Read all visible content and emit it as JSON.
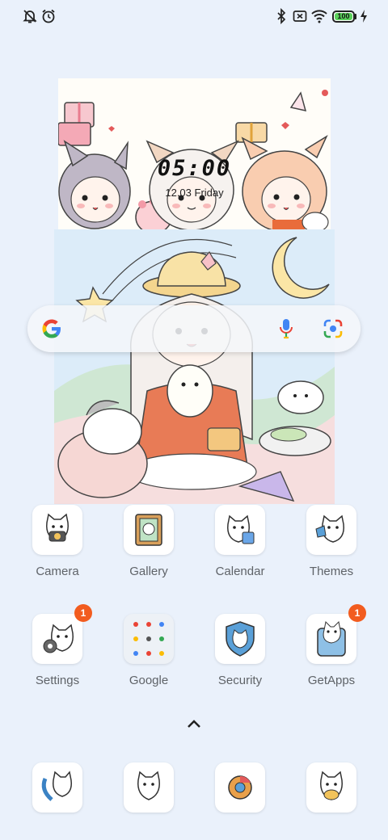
{
  "status": {
    "battery": "100",
    "battery_level_percent": 100,
    "icons": [
      "mute-bell-icon",
      "alarm-icon",
      "bluetooth-icon",
      "no-sim-icon",
      "wifi-icon",
      "battery-icon",
      "charging-bolt-icon"
    ]
  },
  "widget": {
    "time": "05:00",
    "date": "12.03 Friday"
  },
  "search": {
    "icons": [
      "google-logo",
      "mic-icon",
      "lens-icon"
    ]
  },
  "apps": {
    "row1": [
      {
        "label": "Camera"
      },
      {
        "label": "Gallery"
      },
      {
        "label": "Calendar"
      },
      {
        "label": "Themes"
      }
    ],
    "row2": [
      {
        "label": "Settings",
        "badge": "1"
      },
      {
        "label": "Google"
      },
      {
        "label": "Security"
      },
      {
        "label": "GetApps",
        "badge": "1"
      }
    ]
  },
  "dock": {
    "icons": [
      "phone-icon",
      "messages-icon",
      "chrome-icon",
      "contacts-icon"
    ]
  },
  "colors": {
    "background": "#eaf1fb",
    "badge": "#f25c1f",
    "battery_fill": "#5bd15b",
    "label": "#5f6368"
  }
}
